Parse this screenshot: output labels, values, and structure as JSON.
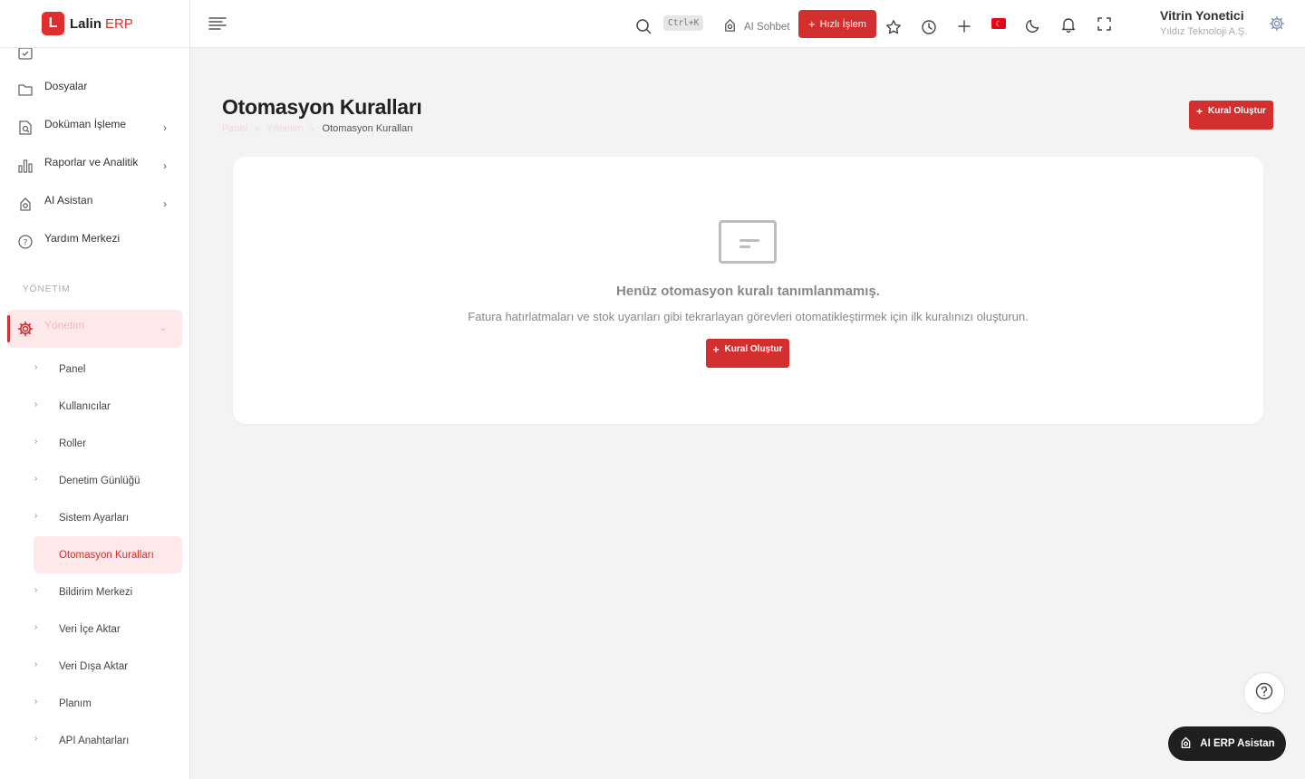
{
  "brand": {
    "mark": "L",
    "name": "Lalin",
    "suffix": "ERP"
  },
  "sidebar": {
    "top_items": [
      {
        "label": "Dosyalar",
        "icon": "folder-icon"
      },
      {
        "label": "Doküman İşleme",
        "icon": "document-search-icon"
      },
      {
        "label": "Raporlar ve Analitik",
        "icon": "bar-chart-icon"
      },
      {
        "label": "AI Asistan",
        "icon": "robot-icon"
      },
      {
        "label": "Yardım Merkezi",
        "icon": "help-circle-icon"
      }
    ],
    "section_title": "YÖNETİM",
    "group": {
      "label": "Yönetim",
      "icon": "gear-icon"
    },
    "sub_items": [
      {
        "label": "Panel"
      },
      {
        "label": "Kullanıcılar"
      },
      {
        "label": "Roller"
      },
      {
        "label": "Denetim Günlüğü"
      },
      {
        "label": "Sistem Ayarları"
      },
      {
        "label": "Otomasyon Kuralları"
      },
      {
        "label": "Bildirim Merkezi"
      },
      {
        "label": "Veri İçe Aktar"
      },
      {
        "label": "Veri Dışa Aktar"
      },
      {
        "label": "Planım"
      },
      {
        "label": "API Anahtarları"
      }
    ]
  },
  "topbar": {
    "shortcut": "Ctrl+K",
    "ai_chat": "AI Sohbet",
    "quick_action": "Hızlı İşlem",
    "user_name": "Vitrin Yonetici",
    "company": "Yıldız Teknoloji A.Ş.",
    "accent": "#d32f2f"
  },
  "page": {
    "title": "Otomasyon Kuralları",
    "breadcrumb": [
      "Panel",
      "Yönetim",
      "Otomasyon Kuralları"
    ],
    "create_button": "Kural Oluştur"
  },
  "empty_state": {
    "title": "Henüz otomasyon kuralı tanımlanmamış.",
    "description": "Fatura hatırlatmaları ve stok uyarıları gibi tekrarlayan görevleri otomatikleştirmek için ilk kuralınızı oluşturun.",
    "button": "Kural Oluştur"
  },
  "fab": {
    "assistant": "AI ERP Asistan"
  }
}
